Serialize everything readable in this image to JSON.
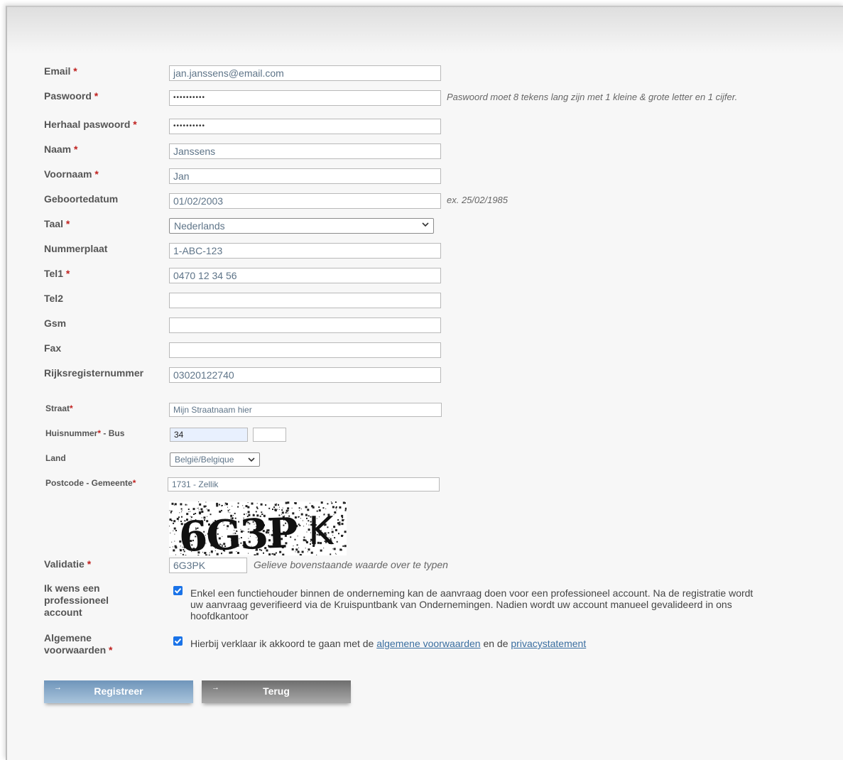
{
  "form": {
    "fields": [
      {
        "label": "Email",
        "value": "jan.janssens@email.com"
      },
      {
        "label": "Paswoord",
        "value": "••••••••••",
        "hint": "Paswoord moet 8 tekens lang zijn met 1 kleine & grote letter en 1 cijfer."
      },
      {
        "label": "Herhaal paswoord",
        "value": "••••••••••"
      },
      {
        "label": "Naam",
        "value": "Janssens"
      },
      {
        "label": "Voornaam",
        "value": "Jan"
      },
      {
        "label": "Geboortedatum",
        "value": "01/02/2003",
        "hint": "ex. 25/02/1985"
      },
      {
        "label": "Taal",
        "value": "Nederlands"
      },
      {
        "label": "Nummerplaat",
        "value": "1-ABC-123"
      },
      {
        "label": "Tel1",
        "value": "0470 12 34 56"
      },
      {
        "label": "Tel2",
        "value": ""
      },
      {
        "label": "Gsm",
        "value": ""
      },
      {
        "label": "Fax",
        "value": ""
      },
      {
        "label": "Rijksregisternummer",
        "value": "03020122740"
      }
    ],
    "required_mark": "*",
    "address": {
      "straat_label": "Straat",
      "straat_value": "Mijn Straatnaam hier",
      "huisnummer_label": "Huisnummer",
      "bus_label": "- Bus",
      "huisnummer_value": "34",
      "bus_value": "",
      "land_label": "Land",
      "land_value": "België/Belgique",
      "postcode_label": "Postcode - Gemeente",
      "postcode_value": "1731 - Zellik"
    },
    "captcha": {
      "image_text": "6G3PK",
      "label": "Validatie",
      "value": "6G3PK",
      "hint": "Gelieve bovenstaande waarde over te typen"
    },
    "professional": {
      "label": "Ik wens een professioneel account",
      "checked": true,
      "text": "Enkel een functiehouder binnen de onderneming kan de aanvraag doen voor een professioneel account. Na de registratie wordt uw aanvraag geverifieerd via de Kruispuntbank van Ondernemingen. Nadien wordt uw account manueel gevalideerd in ons hoofdkantoor"
    },
    "terms": {
      "label": "Algemene voorwaarden",
      "checked": true,
      "text_before": "Hierbij verklaar ik akkoord te gaan met de",
      "link1": "algemene voorwaarden",
      "text_mid": "en de",
      "link2": "privacystatement"
    },
    "buttons": {
      "register": "Registreer",
      "back": "Terug",
      "arrow": "→"
    }
  },
  "colors": {
    "required": "#c0211f",
    "input_text": "#5e7488",
    "register_button": "#7fa3c5",
    "back_button": "#7b7b7b",
    "checkbox": "#1a73e8",
    "link": "#3a6ea0"
  }
}
